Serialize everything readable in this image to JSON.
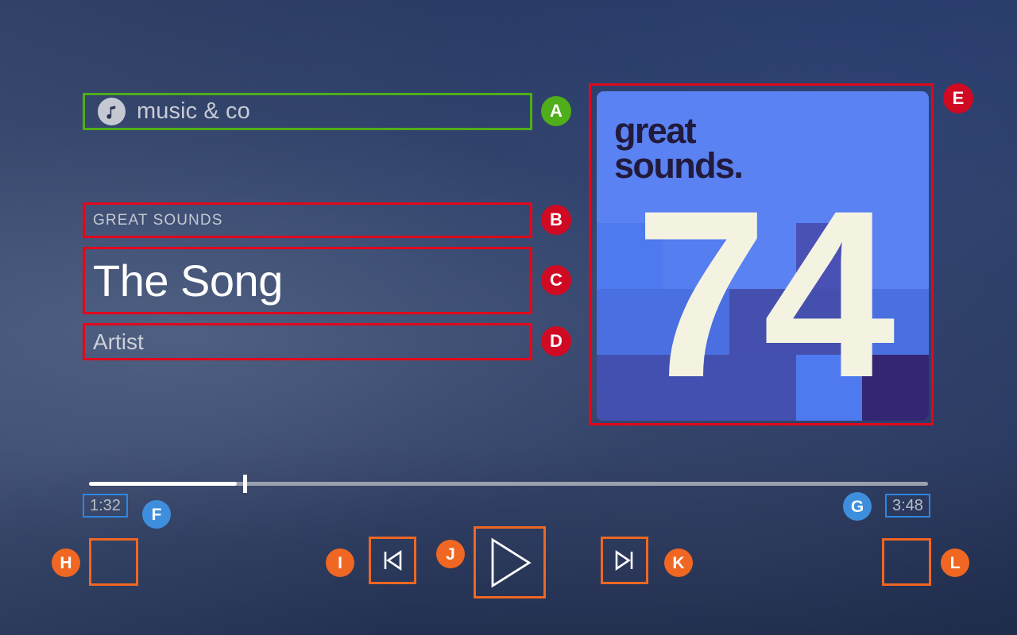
{
  "app": {
    "name": "music & co",
    "icon": "music-note-icon"
  },
  "now_playing": {
    "album": "GREAT SOUNDS",
    "title": "The Song",
    "artist": "Artist",
    "artwork": {
      "wordmark_line1": "great",
      "wordmark_line2": "sounds.",
      "number": "74"
    }
  },
  "progress": {
    "current_time": "1:32",
    "total_time": "3:48",
    "percent": 17.6
  },
  "controls": {
    "shuffle": "",
    "previous": "previous-track-icon",
    "play": "play-icon",
    "next": "next-track-icon",
    "repeat": ""
  },
  "annotations": [
    {
      "id": "A",
      "label": "A",
      "color": "#4fae19",
      "target": "app-name-chip"
    },
    {
      "id": "B",
      "label": "B",
      "color": "#cf0a22",
      "target": "album-label"
    },
    {
      "id": "C",
      "label": "C",
      "color": "#cf0a22",
      "target": "track-title"
    },
    {
      "id": "D",
      "label": "D",
      "color": "#cf0a22",
      "target": "artist-name"
    },
    {
      "id": "E",
      "label": "E",
      "color": "#cf0a22",
      "target": "album-artwork"
    },
    {
      "id": "F",
      "label": "F",
      "color": "#3d8fdd",
      "target": "current-time"
    },
    {
      "id": "G",
      "label": "G",
      "color": "#3d8fdd",
      "target": "total-time"
    },
    {
      "id": "H",
      "label": "H",
      "color": "#ef6722",
      "target": "shuffle-button"
    },
    {
      "id": "I",
      "label": "I",
      "color": "#ef6722",
      "target": "previous-button"
    },
    {
      "id": "J",
      "label": "J",
      "color": "#ef6722",
      "target": "play-button"
    },
    {
      "id": "K",
      "label": "K",
      "color": "#ef6722",
      "target": "next-button"
    },
    {
      "id": "L",
      "label": "L",
      "color": "#ef6722",
      "target": "repeat-button"
    }
  ],
  "colors": {
    "highlight_green": "#4fae19",
    "highlight_red": "#e1081c",
    "highlight_blue": "#2e87e0",
    "highlight_orange": "#ef6722",
    "artwork_blue": "#5b82f2",
    "artwork_cream": "#f4f3e2",
    "artwork_navy": "#221a3c"
  },
  "artwork_tiles": [
    "#5b82f2",
    "#5b82f2",
    "#5b82f2",
    "#5b82f2",
    "#5b82f2",
    "#5b82f2",
    "#5b82f2",
    "#5b82f2",
    "#5b82f2",
    "#5b82f2",
    "#4f79ee",
    "#557ef0",
    "#5b82f2",
    "#4a51b5",
    "#5b82f2",
    "#4a6fe0",
    "#4a6fe0",
    "#4550ae",
    "#4550ae",
    "#4a6fe0",
    "#4450b0",
    "#4450b0",
    "#4450b0",
    "#4f79ee",
    "#342672"
  ]
}
